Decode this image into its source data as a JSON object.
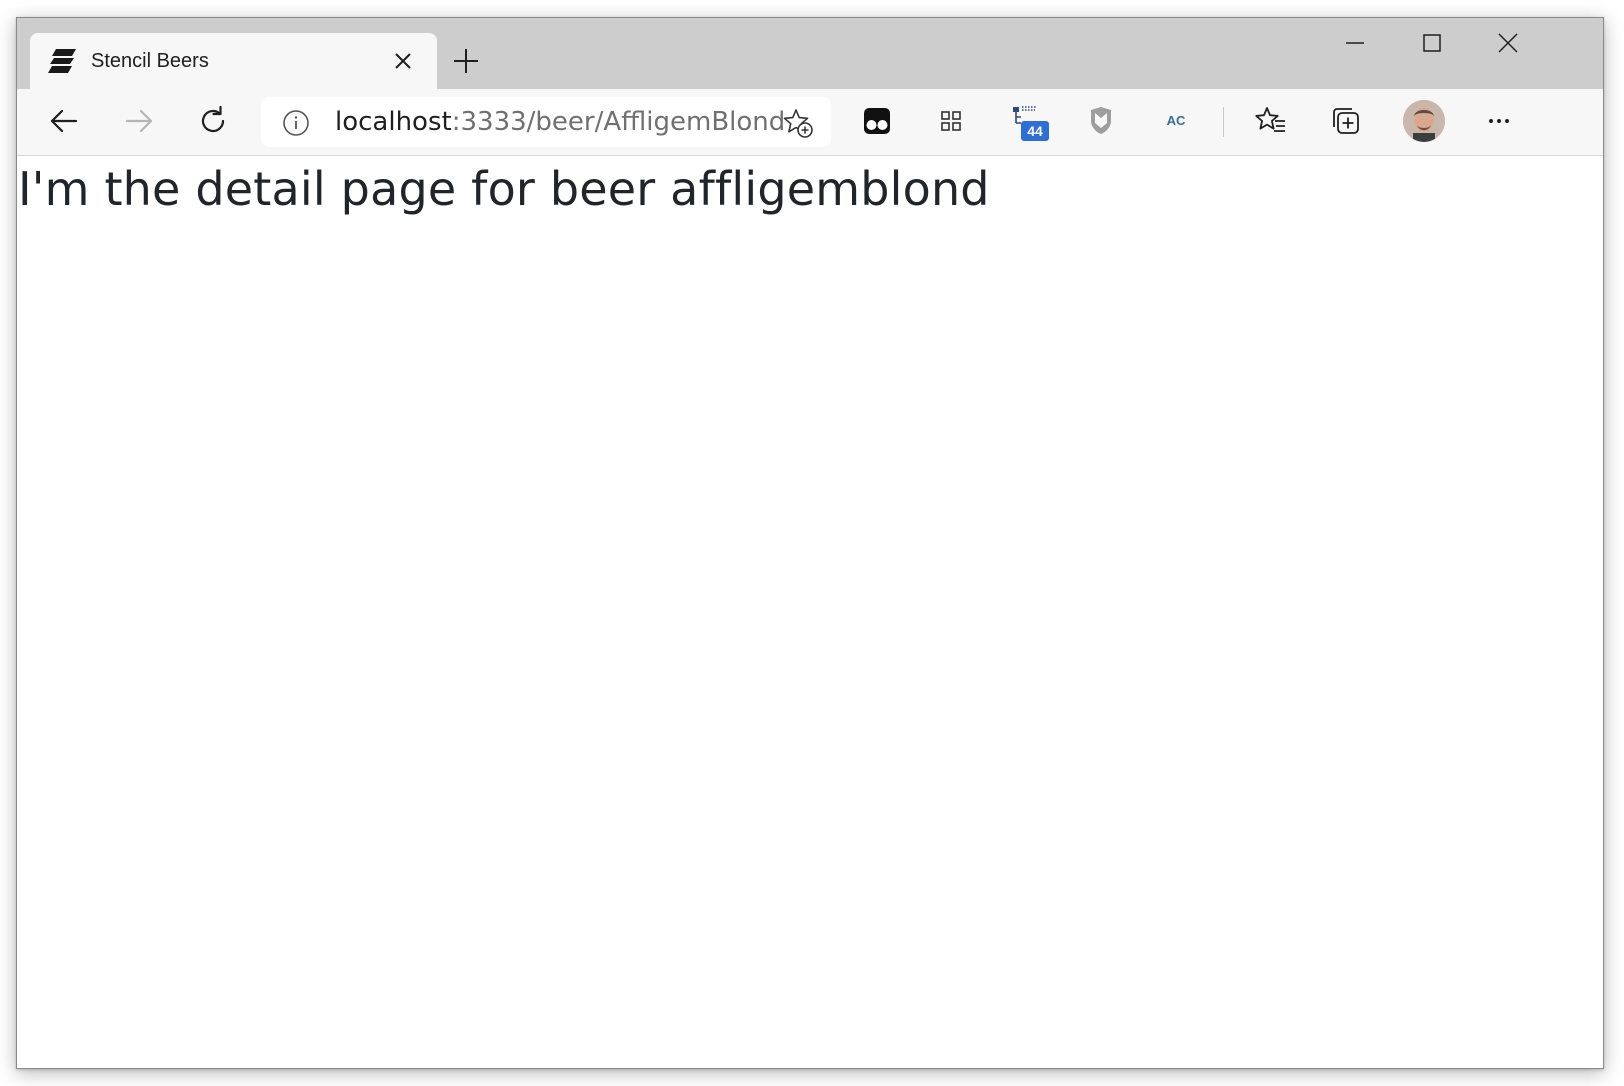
{
  "browser": {
    "tab": {
      "title": "Stencil Beers"
    },
    "address_bar": {
      "url_host": "localhost",
      "url_rest": ":3333/beer/AffligemBlond"
    },
    "extensions": {
      "badge_count": "44",
      "ac_label": "AC"
    }
  },
  "page": {
    "heading": "I'm the detail page for beer affligemblond"
  }
}
